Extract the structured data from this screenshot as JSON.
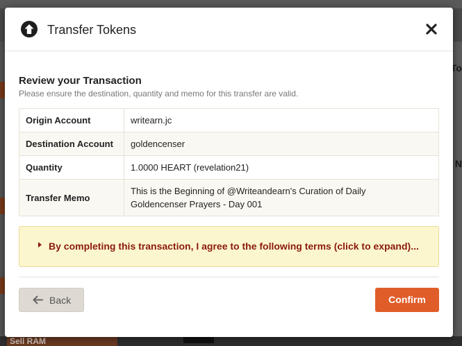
{
  "modal": {
    "title": "Transfer Tokens",
    "icon": "arrow-up-circle-icon",
    "close_icon": "close-icon"
  },
  "review": {
    "heading": "Review your Transaction",
    "subheading": "Please ensure the destination, quantity and memo for this transfer are valid.",
    "rows": [
      {
        "label": "Origin Account",
        "value": "writearn.jc"
      },
      {
        "label": "Destination Account",
        "value": "goldencenser"
      },
      {
        "label": "Quantity",
        "value": "1.0000 HEART (revelation21)"
      },
      {
        "label": "Transfer Memo",
        "value_line1": "This is the Beginning of @Writeandearn's Curation of Daily",
        "value_line2": "Goldencenser Prayers - Day 001"
      }
    ]
  },
  "terms": {
    "text": "By completing this transaction, I agree to the following terms (click to expand)..."
  },
  "actions": {
    "back_label": "Back",
    "confirm_label": "Confirm"
  },
  "background": {
    "sell_ram": "Sell RAM",
    "right_char_1": "To",
    "right_char_2": "N"
  },
  "colors": {
    "confirm": "#e05d2a",
    "terms_bg": "#fcf6cf",
    "terms_text": "#8a1a0c",
    "back_bg": "#dedad3"
  }
}
